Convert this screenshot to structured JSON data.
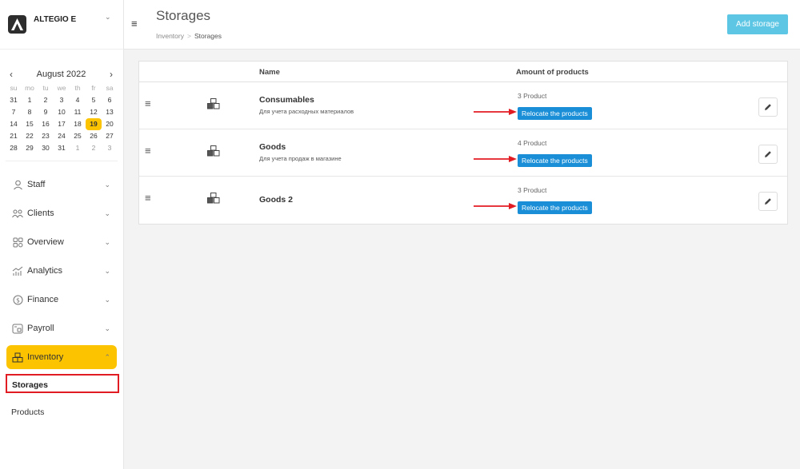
{
  "brand": {
    "name": "ALTEGIO E"
  },
  "calendar": {
    "month_label": "August 2022",
    "weekdays": [
      "su",
      "mo",
      "tu",
      "we",
      "th",
      "fr",
      "sa"
    ],
    "weeks": [
      [
        "31",
        "1",
        "2",
        "3",
        "4",
        "5",
        "6"
      ],
      [
        "7",
        "8",
        "9",
        "10",
        "11",
        "12",
        "13"
      ],
      [
        "14",
        "15",
        "16",
        "17",
        "18",
        "19",
        "20"
      ],
      [
        "21",
        "22",
        "23",
        "24",
        "25",
        "26",
        "27"
      ],
      [
        "28",
        "29",
        "30",
        "31",
        "1",
        "2",
        "3"
      ]
    ],
    "selected_day": "19"
  },
  "nav": {
    "items": [
      {
        "label": "Staff",
        "icon": "person-icon"
      },
      {
        "label": "Clients",
        "icon": "clients-icon"
      },
      {
        "label": "Overview",
        "icon": "overview-icon"
      },
      {
        "label": "Analytics",
        "icon": "analytics-icon"
      },
      {
        "label": "Finance",
        "icon": "finance-icon"
      },
      {
        "label": "Payroll",
        "icon": "payroll-icon"
      },
      {
        "label": "Inventory",
        "icon": "inventory-icon"
      }
    ],
    "subitems": [
      {
        "label": "Storages"
      },
      {
        "label": "Products"
      }
    ]
  },
  "header": {
    "title": "Storages",
    "breadcrumb": {
      "parent": "Inventory",
      "separator": ">",
      "current": "Storages"
    },
    "add_button": "Add storage"
  },
  "table": {
    "columns": {
      "name": "Name",
      "amount": "Amount of products"
    },
    "rows": [
      {
        "name": "Consumables",
        "description": "Для учета расходных материалов",
        "count": "3 Product",
        "action": "Relocate the products"
      },
      {
        "name": "Goods",
        "description": "Для учета продаж в магазине",
        "count": "4 Product",
        "action": "Relocate the products"
      },
      {
        "name": "Goods 2",
        "description": "",
        "count": "3 Product",
        "action": "Relocate the products"
      }
    ]
  },
  "colors": {
    "accent": "#fcc400",
    "primary_button": "#1a8fd8",
    "add_button": "#5cc6e4",
    "annotation_red": "#e21c23"
  }
}
